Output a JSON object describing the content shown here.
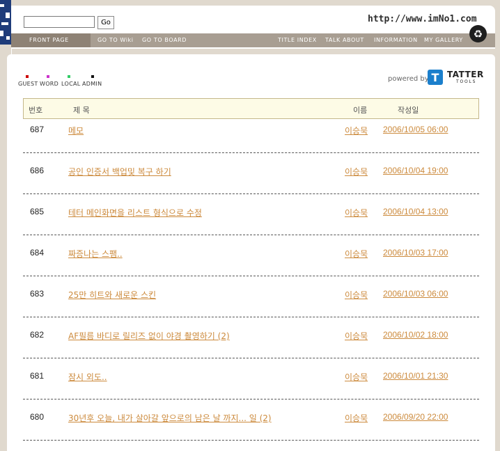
{
  "header": {
    "search": {
      "value": "",
      "placeholder": ""
    },
    "go_label": "Go",
    "site_url": "http://www.imNo1.com",
    "nav_left": [
      "FRONT PAGE",
      "GO TO Wiki",
      "GO TO BOARD"
    ],
    "nav_right": [
      "TITLE INDEX",
      "TALK ABOUT",
      "INFORMATION",
      "MY GALLERY"
    ]
  },
  "modes": {
    "items": [
      {
        "label": "GUEST",
        "color": "#cc0000"
      },
      {
        "label": "WORD",
        "color": "#cc33cc"
      },
      {
        "label": "LOCAL",
        "color": "#33cc66"
      },
      {
        "label": "ADMIN",
        "color": "#111111"
      }
    ]
  },
  "powered": {
    "text": "powered by",
    "brand": "TATTER",
    "sub": "TOOLS"
  },
  "table": {
    "headers": {
      "num": "번호",
      "title": "제  목",
      "name": "이름",
      "date": "작성일"
    },
    "rows": [
      {
        "num": "687",
        "title": "메모",
        "name": "이승묵",
        "date": "2006/10/05 06:00"
      },
      {
        "num": "686",
        "title": "공인 인증서 백업및 복구 하기",
        "name": "이승묵",
        "date": "2006/10/04 19:00"
      },
      {
        "num": "685",
        "title": "테터 메인화면을 리스트 형식으로 수정",
        "name": "이승묵",
        "date": "2006/10/04 13:00"
      },
      {
        "num": "684",
        "title": "짜증나는 스팸..",
        "name": "이승묵",
        "date": "2006/10/03 17:00"
      },
      {
        "num": "683",
        "title": "25만 히트와 새로운 스킨",
        "name": "이승묵",
        "date": "2006/10/03 06:00"
      },
      {
        "num": "682",
        "title": "AF필름 바디로 릴리즈 없이 야경 촬영하기 (2)",
        "name": "이승묵",
        "date": "2006/10/02 18:00"
      },
      {
        "num": "681",
        "title": "잠시 외도..",
        "name": "이승묵",
        "date": "2006/10/01 21:30"
      },
      {
        "num": "680",
        "title": "30년후 오늘, 내가 살아갈 앞으로의 남은 날 까지... 일 (2)",
        "name": "이승묵",
        "date": "2006/09/20 22:00"
      }
    ]
  }
}
